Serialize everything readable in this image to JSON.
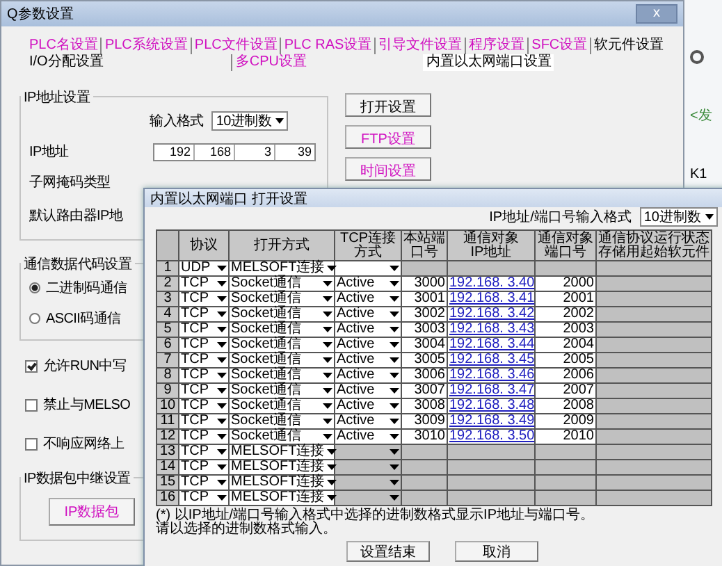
{
  "window": {
    "title": "Q参数设置",
    "close": "x"
  },
  "tab_rows": [
    {
      "tabs": [
        {
          "label": "PLC名设置",
          "modified": true,
          "selected": false
        },
        {
          "label": "PLC系统设置",
          "modified": true,
          "selected": false
        },
        {
          "label": "PLC文件设置",
          "modified": true,
          "selected": false
        },
        {
          "label": "PLC RAS设置",
          "modified": true,
          "selected": false
        },
        {
          "label": "引导文件设置",
          "modified": true,
          "selected": false
        },
        {
          "label": "程序设置",
          "modified": true,
          "selected": false
        },
        {
          "label": "SFC设置",
          "modified": true,
          "selected": false
        },
        {
          "label": "软元件设置",
          "modified": false,
          "selected": false
        }
      ]
    },
    {
      "tabs": [
        {
          "label": "I/O分配设置",
          "modified": false,
          "selected": false
        },
        {
          "label": "多CPU设置",
          "modified": true,
          "selected": false
        },
        {
          "label": "内置以太网端口设置",
          "modified": false,
          "selected": true
        }
      ]
    }
  ],
  "ip_group": {
    "title": "IP地址设置",
    "format_label": "输入格式",
    "format_value": "10进制数",
    "ip_label": "IP地址",
    "ip": [
      "192",
      "168",
      "3",
      "39"
    ],
    "subnet_label": "子网掩码类型",
    "router_label": "默认路由器IP地"
  },
  "side_buttons": [
    {
      "label": "打开设置",
      "modified": false
    },
    {
      "label": "FTP设置",
      "modified": true
    },
    {
      "label": "时间设置",
      "modified": true
    }
  ],
  "code_group": {
    "title": "通信数据代码设置",
    "options": [
      {
        "label": "二进制码通信",
        "selected": true
      },
      {
        "label": "ASCII码通信",
        "selected": false
      }
    ]
  },
  "checks": [
    {
      "label": "允许RUN中写",
      "checked": true
    },
    {
      "label": "禁止与MELSO",
      "checked": false
    },
    {
      "label": "不响应网络上",
      "checked": false
    }
  ],
  "relay_group": {
    "title": "IP数据包中继设置",
    "button": "IP数据包"
  },
  "side_strip": {
    "texts": [
      "<发",
      "K1"
    ]
  },
  "dialog": {
    "title": "内置以太网端口 打开设置",
    "format_label": "IP地址/端口号输入格式",
    "format_value": "10进制数",
    "columns": [
      "协议",
      "打开方式",
      "TCP连接方式",
      "本站端口号",
      "通信对象IP地址",
      "通信对象端口号",
      "通信协议运行状态存储用起始软元件"
    ],
    "rows": [
      {
        "no": "1",
        "protocol": "UDP",
        "open": "MELSOFT连接",
        "tcp_enabled": true
      },
      {
        "no": "2",
        "protocol": "TCP",
        "open": "Socket通信",
        "tcp_enabled": true,
        "tcp": "Active",
        "port": "3000",
        "ip": "192.168. 3.40",
        "target_port": "2000"
      },
      {
        "no": "3",
        "protocol": "TCP",
        "open": "Socket通信",
        "tcp_enabled": true,
        "tcp": "Active",
        "port": "3001",
        "ip": "192.168. 3.41",
        "target_port": "2001"
      },
      {
        "no": "4",
        "protocol": "TCP",
        "open": "Socket通信",
        "tcp_enabled": true,
        "tcp": "Active",
        "port": "3002",
        "ip": "192.168. 3.42",
        "target_port": "2002"
      },
      {
        "no": "5",
        "protocol": "TCP",
        "open": "Socket通信",
        "tcp_enabled": true,
        "tcp": "Active",
        "port": "3003",
        "ip": "192.168. 3.43",
        "target_port": "2003"
      },
      {
        "no": "6",
        "protocol": "TCP",
        "open": "Socket通信",
        "tcp_enabled": true,
        "tcp": "Active",
        "port": "3004",
        "ip": "192.168. 3.44",
        "target_port": "2004"
      },
      {
        "no": "7",
        "protocol": "TCP",
        "open": "Socket通信",
        "tcp_enabled": true,
        "tcp": "Active",
        "port": "3005",
        "ip": "192.168. 3.45",
        "target_port": "2005"
      },
      {
        "no": "8",
        "protocol": "TCP",
        "open": "Socket通信",
        "tcp_enabled": true,
        "tcp": "Active",
        "port": "3006",
        "ip": "192.168. 3.46",
        "target_port": "2006"
      },
      {
        "no": "9",
        "protocol": "TCP",
        "open": "Socket通信",
        "tcp_enabled": true,
        "tcp": "Active",
        "port": "3007",
        "ip": "192.168. 3.47",
        "target_port": "2007"
      },
      {
        "no": "10",
        "protocol": "TCP",
        "open": "Socket通信",
        "tcp_enabled": true,
        "tcp": "Active",
        "port": "3008",
        "ip": "192.168. 3.48",
        "target_port": "2008"
      },
      {
        "no": "11",
        "protocol": "TCP",
        "open": "Socket通信",
        "tcp_enabled": true,
        "tcp": "Active",
        "port": "3009",
        "ip": "192.168. 3.49",
        "target_port": "2009"
      },
      {
        "no": "12",
        "protocol": "TCP",
        "open": "Socket通信",
        "tcp_enabled": true,
        "tcp": "Active",
        "port": "3010",
        "ip": "192.168. 3.50",
        "target_port": "2010"
      },
      {
        "no": "13",
        "protocol": "TCP",
        "open": "MELSOFT连接",
        "tcp_enabled": false
      },
      {
        "no": "14",
        "protocol": "TCP",
        "open": "MELSOFT连接",
        "tcp_enabled": false
      },
      {
        "no": "15",
        "protocol": "TCP",
        "open": "MELSOFT连接",
        "tcp_enabled": false
      },
      {
        "no": "16",
        "protocol": "TCP",
        "open": "MELSOFT连接",
        "tcp_enabled": false
      }
    ],
    "notes": [
      "(*) 以IP地址/端口号输入格式中选择的进制数格式显示IP地址与端口号。",
      "请以选择的进制数格式输入。"
    ],
    "buttons": [
      "设置结束",
      "取消"
    ]
  }
}
